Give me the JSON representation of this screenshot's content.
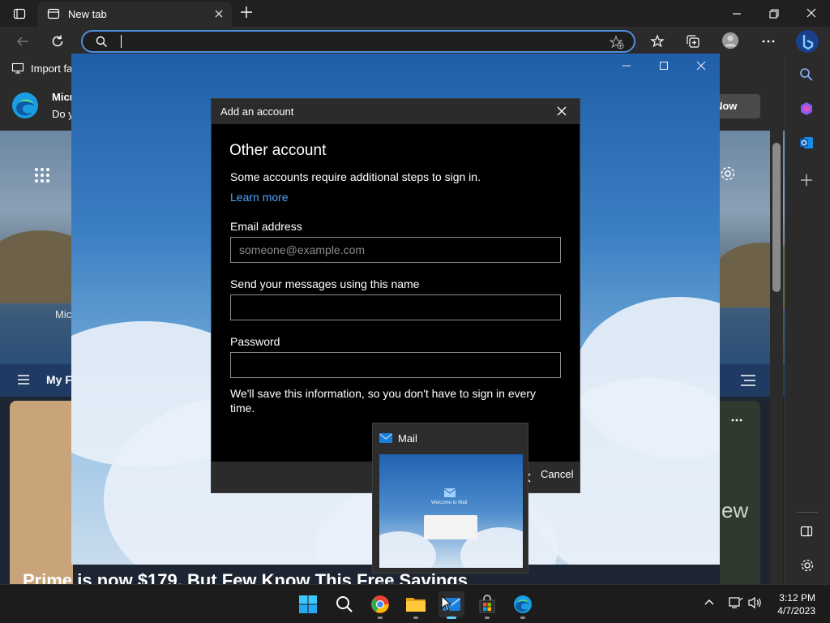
{
  "browser": {
    "tab_title": "New tab",
    "address_value": "",
    "favorites_item": "Import fa",
    "ntp": {
      "banner_title": "Micr",
      "banner_text": "Do y",
      "banner_button": "t Now",
      "tile_label": "Mic",
      "feed_label": "My F",
      "headline": "Prime is now $179. But Few Know This Free Savings",
      "map_text": "ew"
    }
  },
  "mail_window": {
    "dialog": {
      "title": "Add an account",
      "heading": "Other account",
      "subtext": "Some accounts require additional steps to sign in.",
      "learn_more": "Learn more",
      "email_label": "Email address",
      "email_placeholder": "someone@example.com",
      "email_value": "",
      "name_label": "Send your messages using this name",
      "name_value": "",
      "password_label": "Password",
      "password_value": "",
      "save_info": "We'll save this information, so you don't have to sign in every time.",
      "cancel": "Cancel"
    }
  },
  "thumbnail": {
    "title": "Mail",
    "preview_text": "Welcome to Mail"
  },
  "taskbar": {
    "apps": [
      "start",
      "search",
      "chrome",
      "file-explorer",
      "mail",
      "microsoft-store",
      "edge"
    ],
    "time": "3:12 PM",
    "date": "4/7/2023"
  },
  "colors": {
    "accent": "#4e8fd9",
    "link": "#4fa6ff",
    "dialog_bg": "#000000",
    "header_bg": "#2b2b2b"
  }
}
